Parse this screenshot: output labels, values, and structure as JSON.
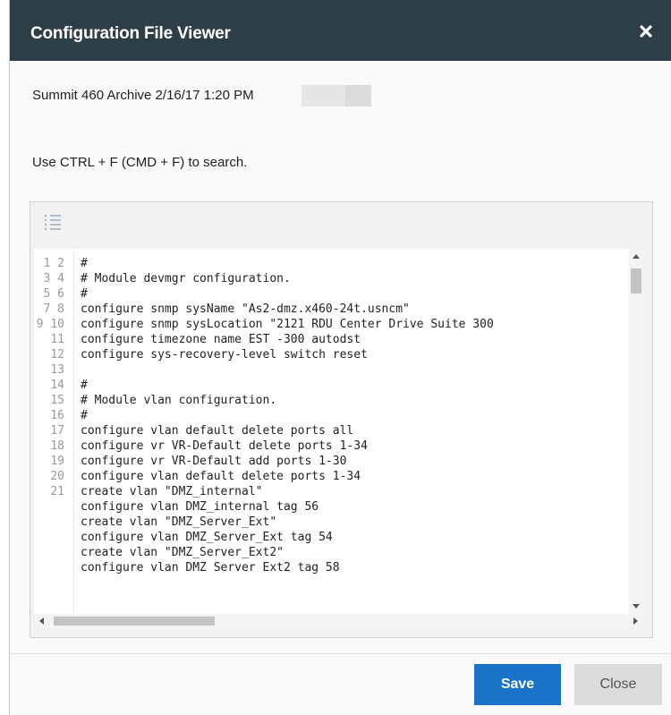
{
  "dialog": {
    "title": "Configuration File Viewer",
    "close_icon": "close-x-icon",
    "subtitle": "Summit 460 Archive 2/16/17 1:20 PM",
    "hint": "Use CTRL + F (CMD + F) to search.",
    "toolbar_icon": "line-numbers-icon"
  },
  "editor": {
    "line_numbers": "1\n2\n3\n4\n5\n6\n7\n8\n9\n10\n11\n12\n13\n14\n15\n16\n17\n18\n19\n20\n21",
    "code": "#\n# Module devmgr configuration.\n#\nconfigure snmp sysName \"As2-dmz.x460-24t.usncm\"\nconfigure snmp sysLocation \"2121 RDU Center Drive Suite 300\nconfigure timezone name EST -300 autodst\nconfigure sys-recovery-level switch reset\n\n#\n# Module vlan configuration.\n#\nconfigure vlan default delete ports all\nconfigure vr VR-Default delete ports 1-34\nconfigure vr VR-Default add ports 1-30\nconfigure vlan default delete ports 1-34\ncreate vlan \"DMZ_internal\"\nconfigure vlan DMZ_internal tag 56\ncreate vlan \"DMZ_Server_Ext\"\nconfigure vlan DMZ_Server_Ext tag 54\ncreate vlan \"DMZ_Server_Ext2\"\nconfigure vlan DMZ Server Ext2 tag 58"
  },
  "buttons": {
    "save": "Save",
    "close": "Close"
  },
  "colors": {
    "titlebar": "#2e3e48",
    "save": "#1b73c9",
    "close": "#dcdcdc"
  }
}
